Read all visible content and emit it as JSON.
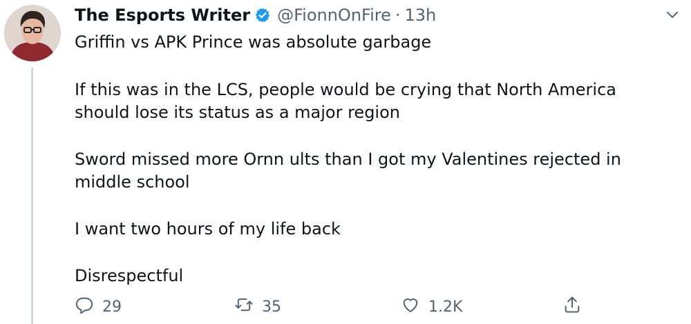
{
  "tweet": {
    "author_name": "The Esports Writer",
    "handle": "@FionnOnFire",
    "separator": "·",
    "time": "13h",
    "lines": [
      "Griffin vs APK Prince was absolute garbage",
      "If this was in the LCS, people would be crying that North America",
      "should lose its status as a major region",
      "Sword missed more Ornn ults than I got my Valentines rejected in",
      "middle school",
      "I want two hours of my life back",
      "Disrespectful"
    ]
  },
  "actions": {
    "reply_count": "29",
    "retweet_count": "35",
    "like_count": "1.2K"
  },
  "icons": [
    "verified-badge-icon",
    "chevron-down-icon",
    "reply-icon",
    "retweet-icon",
    "like-icon",
    "share-icon"
  ],
  "colors": {
    "verified_blue": "#1d9bf0",
    "secondary_text": "#536471",
    "thread_line": "#cfd9de"
  }
}
